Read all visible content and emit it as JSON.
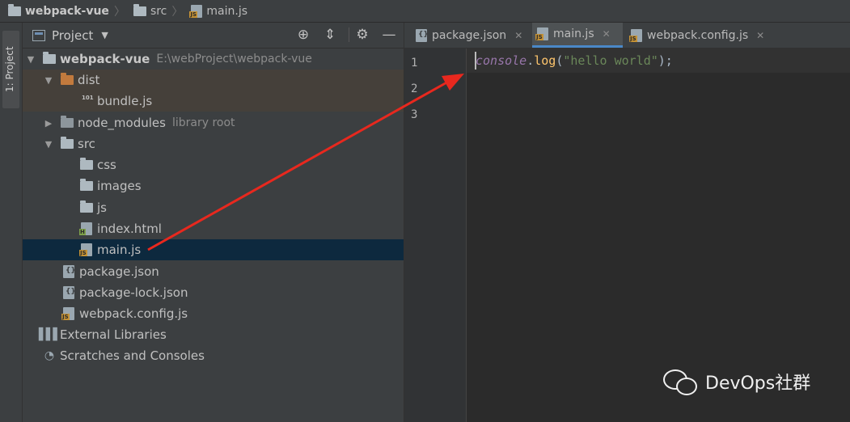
{
  "breadcrumb": {
    "project": "webpack-vue",
    "folder": "src",
    "file": "main.js"
  },
  "side_strip": {
    "tab_label": "1: Project"
  },
  "project_panel": {
    "title": "Project",
    "dropdown_icon": "triangle-down",
    "buttons": [
      "target-icon",
      "collapse-icon",
      "gear-icon",
      "minimize-icon"
    ]
  },
  "tree": {
    "root_name": "webpack-vue",
    "root_path": "E:\\webProject\\webpack-vue",
    "dist": "dist",
    "bundle": "bundle.js",
    "node_modules": "node_modules",
    "node_modules_hint": "library root",
    "src": "src",
    "css": "css",
    "images": "images",
    "js": "js",
    "index_html": "index.html",
    "main_js": "main.js",
    "package_json": "package.json",
    "package_lock": "package-lock.json",
    "webpack_config": "webpack.config.js",
    "external_libraries": "External Libraries",
    "scratches": "Scratches and Consoles"
  },
  "editor": {
    "tabs": [
      {
        "label": "package.json",
        "active": false
      },
      {
        "label": "main.js",
        "active": true
      },
      {
        "label": "webpack.config.js",
        "active": false
      }
    ],
    "line_numbers": [
      "1",
      "2",
      "3"
    ],
    "code": {
      "object": "console",
      "dot": ".",
      "method": "log",
      "open": "(",
      "string": "\"hello world\"",
      "close": ");"
    }
  },
  "annotation": {
    "arrow_color": "#e8281e"
  },
  "watermark": {
    "text": "DevOps社群"
  },
  "colors": {
    "selection": "#0d293e",
    "accent": "#4a88c7",
    "excluded_highlight": "#45403a"
  }
}
